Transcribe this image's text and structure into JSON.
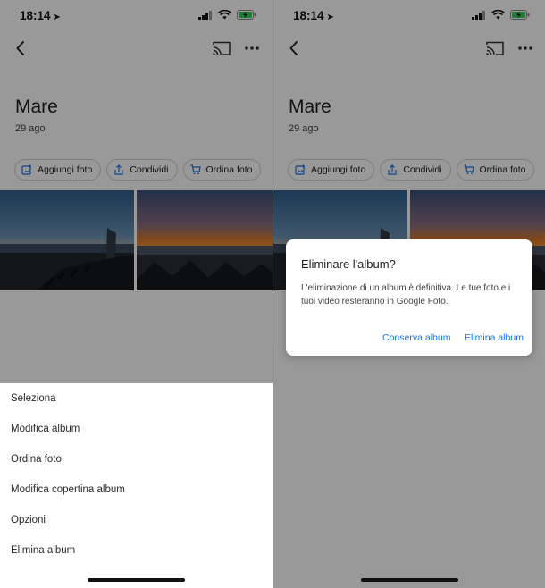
{
  "status": {
    "time": "18:14"
  },
  "album": {
    "title": "Mare",
    "date": "29 ago"
  },
  "chips": {
    "add_photos": "Aggiungi foto",
    "share": "Condividi",
    "order_photos": "Ordina foto"
  },
  "menu": {
    "items": [
      "Seleziona",
      "Modifica album",
      "Ordina foto",
      "Modifica copertina album",
      "Opzioni",
      "Elimina album"
    ]
  },
  "dialog": {
    "title": "Eliminare l'album?",
    "body": "L'eliminazione di un album è definitiva. Le tue foto e i tuoi video resteranno in Google Foto.",
    "keep_label": "Conserva album",
    "delete_label": "Elimina album"
  },
  "colors": {
    "accent": "#1a73e8",
    "overlay": "rgba(0,0,0,0.4)",
    "battery": "#30d158"
  },
  "icons": {
    "back": "arrow-left-icon",
    "cast": "cast-icon",
    "more": "more-horizontal-icon",
    "add_photo": "add-photo-icon",
    "share": "share-icon",
    "order": "cart-icon"
  }
}
